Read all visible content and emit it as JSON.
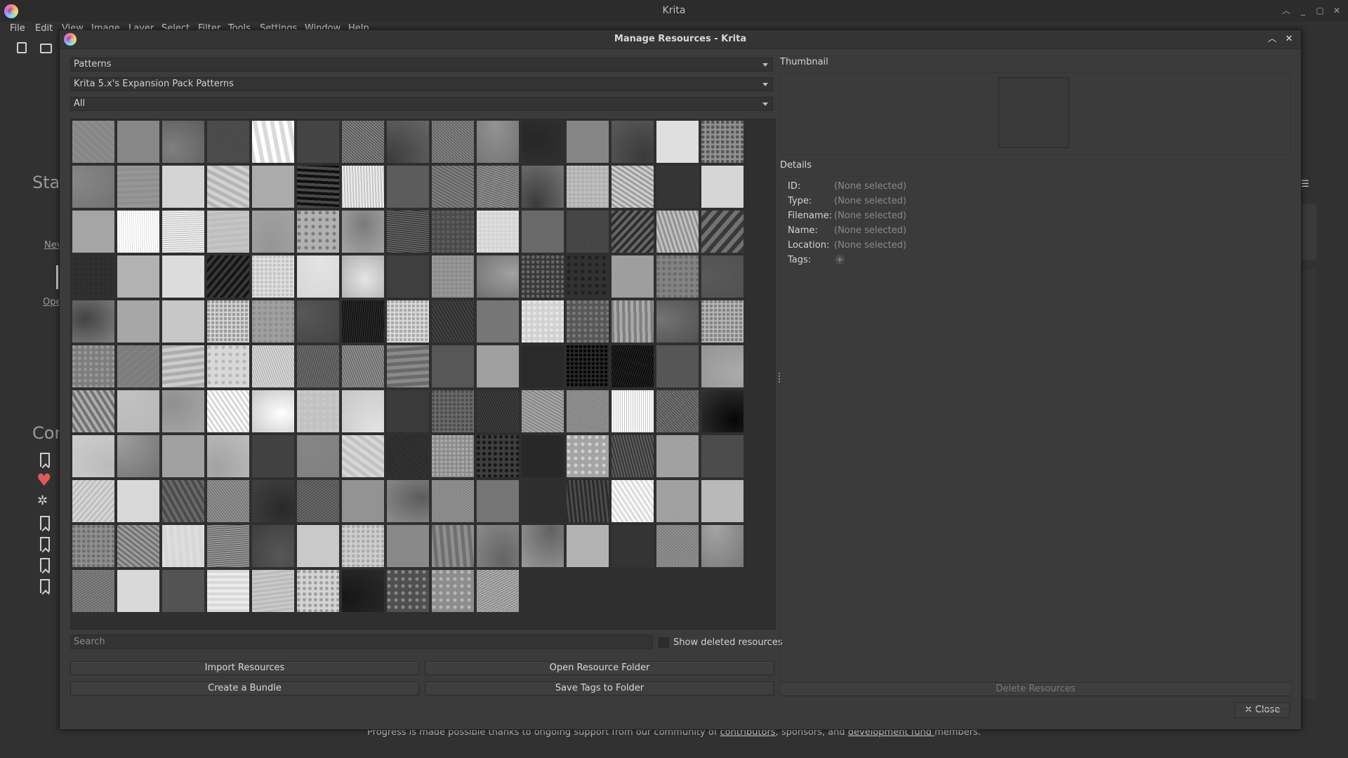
{
  "app": {
    "title": "Krita",
    "menu": [
      "File",
      "Edit",
      "View",
      "Image",
      "Layer",
      "Select",
      "Filter",
      "Tools",
      "Settings",
      "Window",
      "Help"
    ]
  },
  "background": {
    "start_heading": "Sta",
    "new_link": "Nev",
    "open_link": "Ope",
    "community_heading": "Cor",
    "footer": {
      "before": "Progress is made possible thanks to ongoing support from our community of ",
      "link1": "contributors",
      "middle": ", sponsors, and ",
      "link2": "development fund ",
      "after": "members."
    }
  },
  "dialog": {
    "title": "Manage Resources - Krita",
    "resource_type": "Patterns",
    "storage": "Krita 5.x's Expansion Pack Patterns",
    "tag_filter": "All",
    "search_placeholder": "Search",
    "show_deleted_label": "Show deleted resources",
    "buttons": {
      "import": "Import Resources",
      "open_folder": "Open Resource Folder",
      "create_bundle": "Create a Bundle",
      "save_tags": "Save Tags to Folder",
      "delete": "Delete Resources",
      "close": "✕ Close"
    },
    "thumbnail_label": "Thumbnail",
    "details_label": "Details",
    "details": [
      {
        "key": "ID:",
        "value": "(None selected)"
      },
      {
        "key": "Type:",
        "value": "(None selected)"
      },
      {
        "key": "Filename:",
        "value": "(None selected)"
      },
      {
        "key": "Name:",
        "value": "(None selected)"
      },
      {
        "key": "Location:",
        "value": "(None selected)"
      }
    ],
    "tags_label": "Tags:"
  }
}
